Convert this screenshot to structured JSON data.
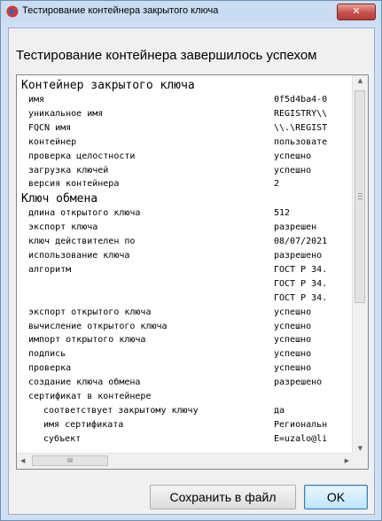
{
  "window": {
    "title": "Тестирование контейнера закрытого ключа",
    "close_glyph": "✕"
  },
  "heading": "Тестирование контейнера завершилось успехом",
  "sections": [
    {
      "title": "Контейнер закрытого ключа",
      "rows": [
        {
          "key": "имя",
          "value": "0f5d4ba4-0"
        },
        {
          "key": "уникальное имя",
          "value": "REGISTRY\\\\"
        },
        {
          "key": "FQCN имя",
          "value": "\\\\.\\REGIST"
        },
        {
          "key": "контейнер",
          "value": "пользовате"
        },
        {
          "key": "проверка целостности",
          "value": "успешно"
        },
        {
          "key": "загрузка ключей",
          "value": "успешно"
        },
        {
          "key": "версия контейнера",
          "value": "2"
        }
      ]
    },
    {
      "title": "Ключ обмена",
      "rows": [
        {
          "key": "длина открытого ключа",
          "value": "512"
        },
        {
          "key": "экспорт ключа",
          "value": "разрешен"
        },
        {
          "key": "ключ действителен по",
          "value": "08/07/2021"
        },
        {
          "key": "использование ключа",
          "value": "разрешено"
        },
        {
          "key": "алгоритм",
          "value": "ГОСТ Р 34."
        },
        {
          "key": "",
          "value": "ГОСТ Р 34."
        },
        {
          "key": "",
          "value": "ГОСТ Р 34."
        },
        {
          "key": "экспорт открытого ключа",
          "value": "успешно"
        },
        {
          "key": "вычисление открытого ключа",
          "value": "успешно"
        },
        {
          "key": "импорт открытого ключа",
          "value": "успешно"
        },
        {
          "key": "подпись",
          "value": "успешно"
        },
        {
          "key": "проверка",
          "value": "успешно"
        },
        {
          "key": "создание ключа обмена",
          "value": "разрешено"
        },
        {
          "key": "сертификат в контейнере",
          "value": ""
        },
        {
          "key": "соответствует закрытому ключу",
          "value": "да",
          "indent": true
        },
        {
          "key": "имя сертификата",
          "value": "Региональн",
          "indent": true
        },
        {
          "key": "субъект",
          "value": "E=uzalo@li",
          "indent": true
        }
      ]
    }
  ],
  "scrollbar_glyphs": {
    "up": "▲",
    "down": "▼",
    "left": "◀",
    "right": "▶",
    "hgrip": "III"
  },
  "buttons": {
    "save": "Сохранить в файл",
    "ok": "OK"
  }
}
